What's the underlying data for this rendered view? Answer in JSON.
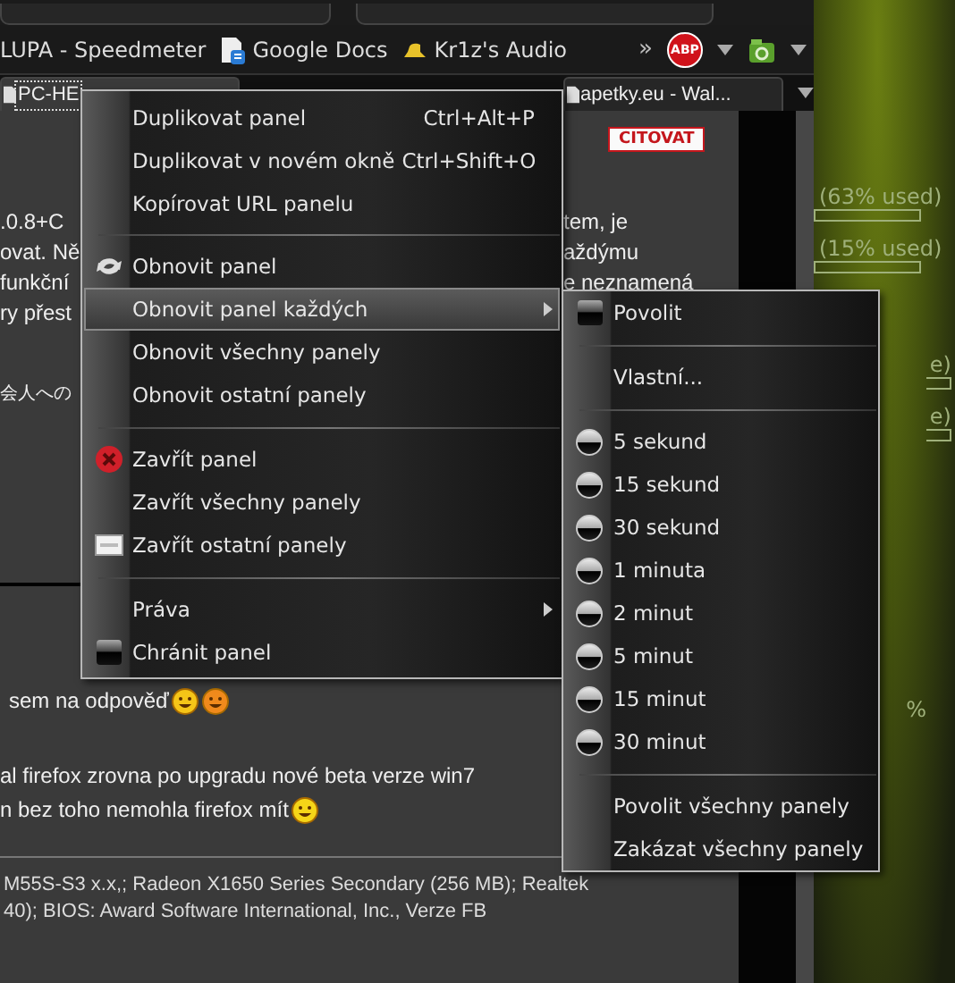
{
  "bookmarks": [
    {
      "label": "LUPA - Speedmeter"
    },
    {
      "label": "Google Docs"
    },
    {
      "label": "Kr1z's Audio"
    }
  ],
  "bookmarks_overflow": "»",
  "extension_button": "ABP",
  "tabs": [
    {
      "label": "PC-HE",
      "selected": true
    },
    {
      "label": "apetky.eu - Wal...",
      "selected": false
    }
  ],
  "page": {
    "quote_button": "CITOVAT",
    "fragment_rows": [
      {
        "left": ".0.8+C",
        "right": "tem, je"
      },
      {
        "left": "ovat. Ně",
        "right": "aždýmu"
      },
      {
        "left": "funkční",
        "right": "e neznamená"
      },
      {
        "left": "ry přest",
        "right": ""
      }
    ],
    "cjk_fragment": "会人への",
    "reply_line": "sem na odpověď",
    "post_lines": [
      "al firefox zrovna po upgradu nové beta verze win7",
      "n bez toho nemohla firefox mít"
    ],
    "system_info": [
      "M55S-S3 x.x,; Radeon X1650 Series Secondary (256 MB); Realtek",
      "40); BIOS: Award Software International, Inc., Verze FB"
    ]
  },
  "desktop": {
    "meters": [
      {
        "label": "(63% used)",
        "partial": false
      },
      {
        "label": "(15% used)",
        "partial": false
      },
      {
        "label": "e)",
        "partial": true
      },
      {
        "label": "e)",
        "partial": true
      }
    ],
    "trailing": "%"
  },
  "context_menu": {
    "items": [
      {
        "kind": "item",
        "label": "Duplikovat panel",
        "shortcut": "Ctrl+Alt+P",
        "has_submenu": false,
        "selected": false
      },
      {
        "kind": "item",
        "label": "Duplikovat v novém okně",
        "shortcut": "Ctrl+Shift+O",
        "has_submenu": false,
        "selected": false
      },
      {
        "kind": "item",
        "label": "Kopírovat URL panelu",
        "has_submenu": false,
        "selected": false
      },
      {
        "kind": "separator"
      },
      {
        "kind": "item",
        "label": "Obnovit panel",
        "has_submenu": false,
        "selected": false
      },
      {
        "kind": "item",
        "label": "Obnovit panel každých",
        "has_submenu": true,
        "selected": true
      },
      {
        "kind": "item",
        "label": "Obnovit všechny panely",
        "has_submenu": false,
        "selected": false
      },
      {
        "kind": "item",
        "label": "Obnovit ostatní panely",
        "has_submenu": false,
        "selected": false
      },
      {
        "kind": "separator"
      },
      {
        "kind": "item",
        "label": "Zavřít panel",
        "has_submenu": false,
        "selected": false
      },
      {
        "kind": "item",
        "label": "Zavřít všechny panely",
        "has_submenu": false,
        "selected": false
      },
      {
        "kind": "item",
        "label": "Zavřít ostatní panely",
        "has_submenu": false,
        "selected": false
      },
      {
        "kind": "separator"
      },
      {
        "kind": "item",
        "label": "Práva",
        "has_submenu": true,
        "selected": false
      },
      {
        "kind": "item",
        "label": "Chránit panel",
        "has_submenu": false,
        "selected": false
      }
    ]
  },
  "submenu": {
    "items": [
      {
        "kind": "toggle",
        "label": "Povolit",
        "checked": false
      },
      {
        "kind": "separator"
      },
      {
        "kind": "item",
        "label": "Vlastní..."
      },
      {
        "kind": "separator"
      },
      {
        "kind": "radio",
        "label": "5  sekund",
        "selected": false
      },
      {
        "kind": "radio",
        "label": "15 sekund",
        "selected": false
      },
      {
        "kind": "radio",
        "label": "30 sekund",
        "selected": false
      },
      {
        "kind": "radio",
        "label": "1  minuta",
        "selected": false
      },
      {
        "kind": "radio",
        "label": "2  minut",
        "selected": false
      },
      {
        "kind": "radio",
        "label": "5  minut",
        "selected": false
      },
      {
        "kind": "radio",
        "label": "15 minut",
        "selected": false
      },
      {
        "kind": "radio",
        "label": "30 minut",
        "selected": false
      },
      {
        "kind": "separator"
      },
      {
        "kind": "item",
        "label": "Povolit všechny panely"
      },
      {
        "kind": "item",
        "label": "Zakázat všechny panely"
      }
    ]
  }
}
